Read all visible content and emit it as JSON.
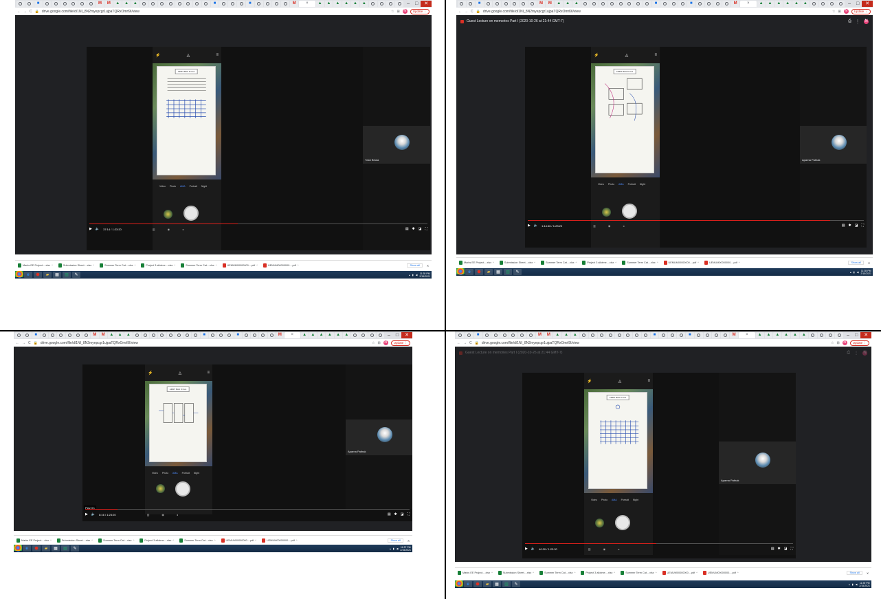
{
  "browser": {
    "url": "drive.google.com/file/d/1NI_8N2myepcgr1ujpaTQRxOmrl9I/view",
    "update_label": "Update",
    "avatar_letter": "N"
  },
  "doc_title": "Guest Lecture on memories Part I (2020-10-26 at 21:44 GMT-7)",
  "phone": {
    "stamp": "ADMT BAU 8 CLA",
    "modes": [
      "Video",
      "Photo",
      "AMA",
      "Portrait",
      "Night"
    ],
    "active_mode": "AMA"
  },
  "panels": [
    {
      "time": "37:14 / 1:23:20",
      "progress": 0.44,
      "participant": "Yash Bhola",
      "show_doc_title": false,
      "speed_tip": ""
    },
    {
      "time": "1:14:46 / 1:23:20",
      "progress": 0.9,
      "participant": "Aparna Pathak",
      "show_doc_title": true,
      "speed_tip": ""
    },
    {
      "time": "8:16 / 1:23:20",
      "progress": 0.1,
      "participant": "Aparna Pathak",
      "show_doc_title": false,
      "speed_tip": "Play (k)"
    },
    {
      "time": "40:30 / 1:23:20",
      "progress": 0.49,
      "participant": "Aparna Pathak",
      "show_doc_title": true,
      "speed_tip": ""
    }
  ],
  "downloads": [
    {
      "label": "Marks EE Project....xlsx",
      "type": "sheet"
    },
    {
      "label": "Submission Sheet....xlsx",
      "type": "sheet"
    },
    {
      "label": "Summer Term Cat....xlsx",
      "type": "sheet"
    },
    {
      "label": "Project 3 allotme....xlsx",
      "type": "sheet"
    },
    {
      "label": "Summer Term Cat....xlsx",
      "type": "sheet"
    },
    {
      "label": "UEMUM00000000....pdf",
      "type": "pdf"
    },
    {
      "label": "UEMUM00000000....pdf",
      "type": "pdf"
    }
  ],
  "downloads_show_all": "Show all",
  "taskbar": {
    "clocks": [
      {
        "time": "11:35 PM",
        "date": "2/15/2021"
      },
      {
        "time": "11:35 PM",
        "date": "2/15/2021"
      },
      {
        "time": "11:37 PM",
        "date": "2/15/2021"
      },
      {
        "time": "11:39 PM",
        "date": "2/15/2021"
      }
    ]
  },
  "colors": {
    "accent_red": "#e0201b",
    "viewer_bg": "#202124",
    "link_blue": "#1a73e8"
  }
}
